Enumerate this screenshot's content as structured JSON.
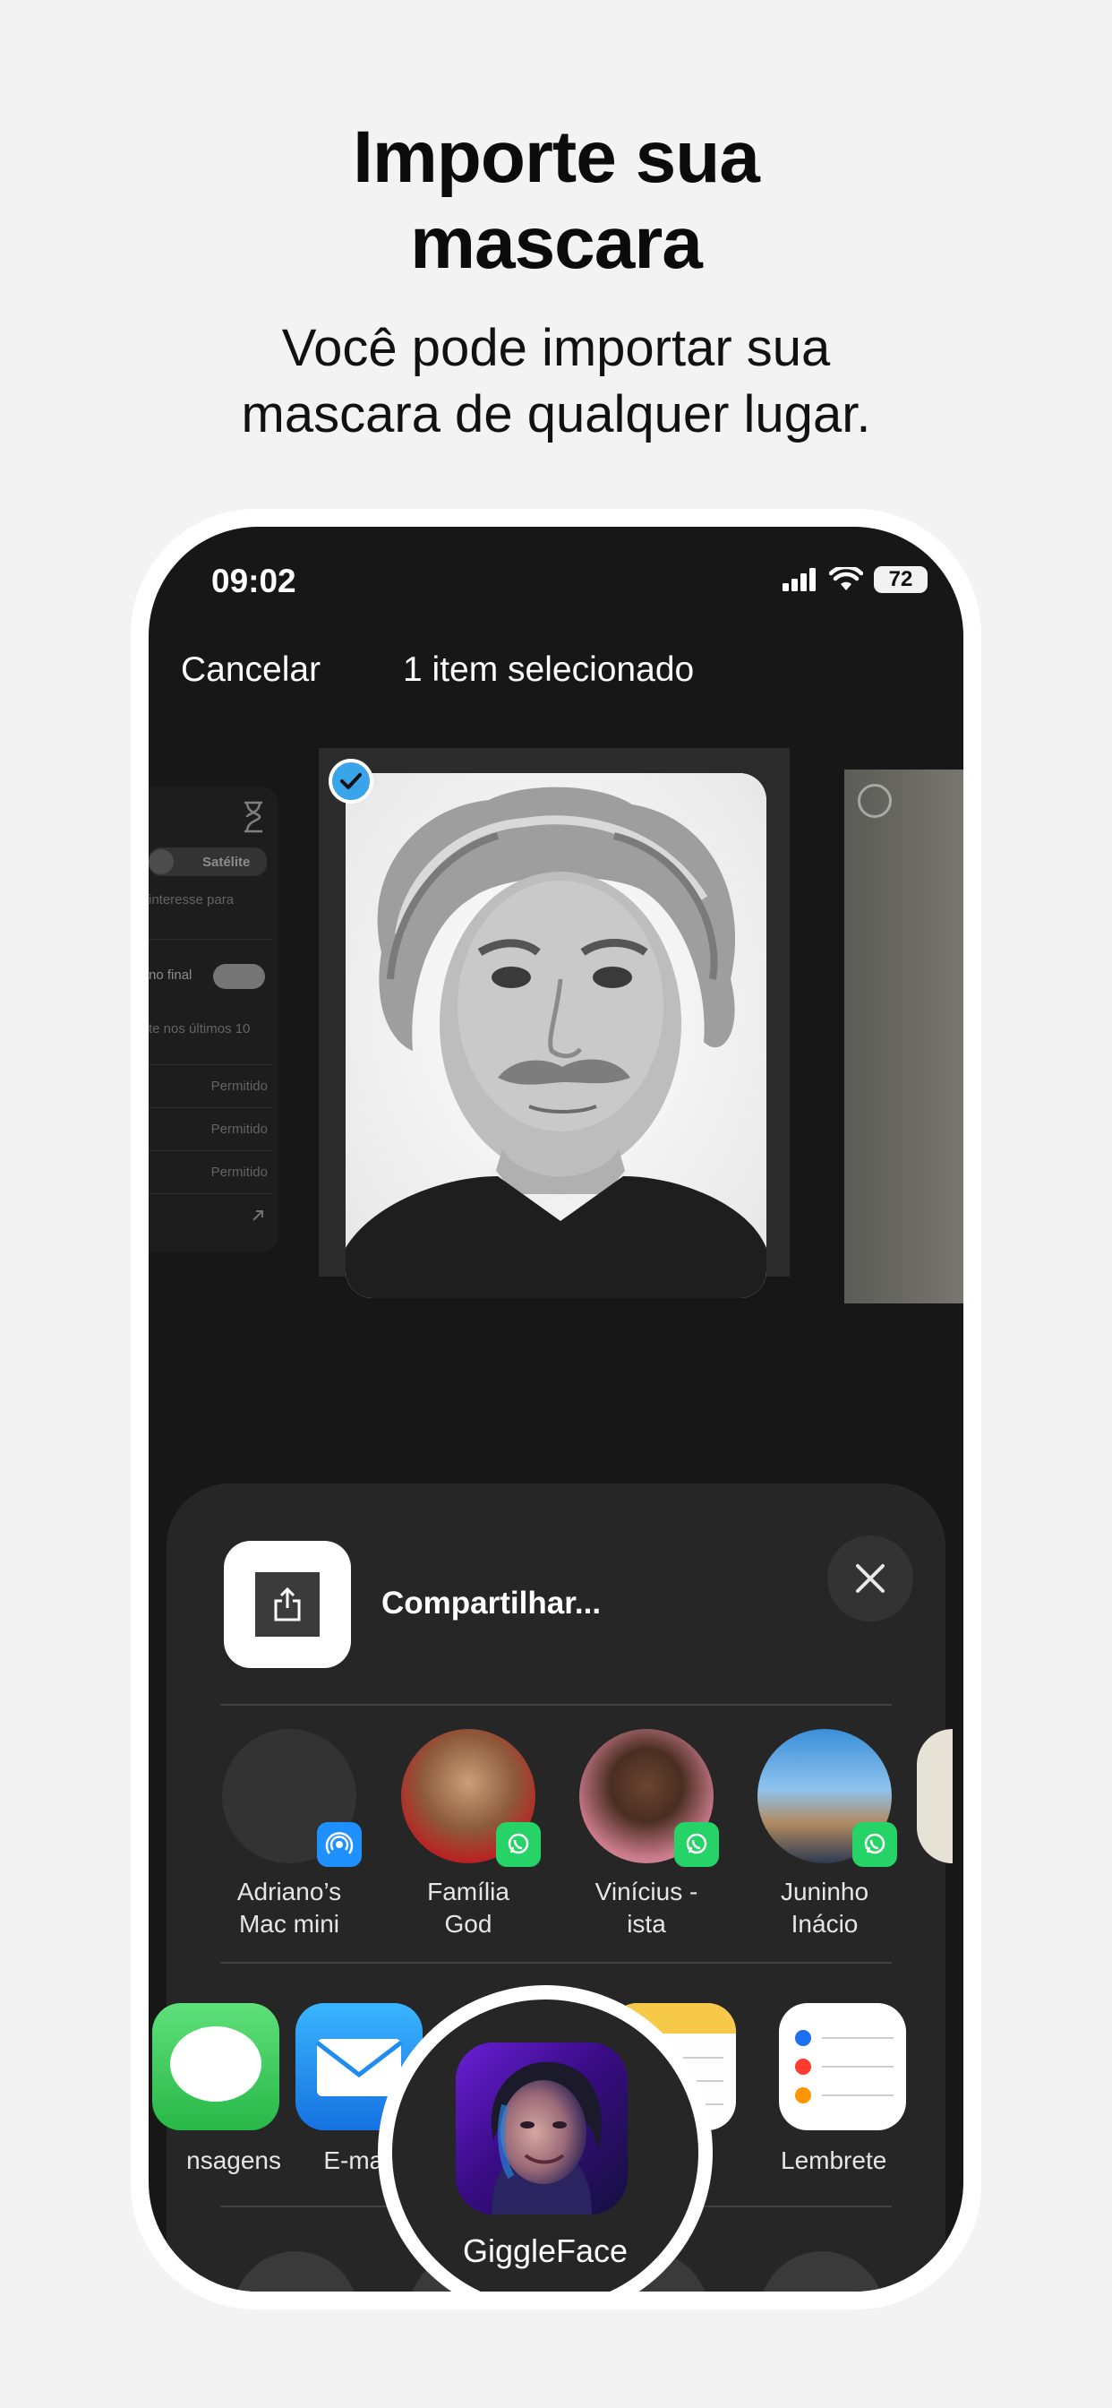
{
  "headline": {
    "title_line1": "Importe sua",
    "title_line2": "mascara",
    "subtitle_line1": "Você pode importar sua",
    "subtitle_line2": "mascara de qualquer lugar."
  },
  "status_bar": {
    "time": "09:02",
    "battery": "72"
  },
  "nav": {
    "cancel": "Cancelar",
    "title": "1 item selecionado"
  },
  "background_panel": {
    "pill_label": "Satélite",
    "text1": "interesse para",
    "toggle_label": "no final",
    "text2": "te nos últimos 10",
    "rows": [
      "Permitido",
      "Permitido",
      "Permitido"
    ]
  },
  "share_sheet": {
    "title": "Compartilhar...",
    "contacts": [
      {
        "line1": "Adriano’s",
        "line2": "Mac mini",
        "badge": "airdrop-icon"
      },
      {
        "line1": "Família",
        "line2": "God",
        "badge": "whatsapp-icon"
      },
      {
        "line1": "Vinícius -",
        "line2": "ista",
        "badge": "whatsapp-icon"
      },
      {
        "line1": "Juninho",
        "line2": "Inácio",
        "badge": "whatsapp-icon"
      }
    ],
    "apps": [
      {
        "label": "nsagens",
        "icon": "messages-icon"
      },
      {
        "label": "E-mail",
        "icon": "mail-icon"
      },
      {
        "label": "Notas",
        "icon": "notes-icon"
      },
      {
        "label": "Lembrete",
        "icon": "reminders-icon"
      }
    ],
    "highlight_app": {
      "label": "GiggleFace",
      "icon": "giggleface-icon"
    }
  },
  "colors": {
    "accent_blue": "#3aa4ea",
    "whatsapp_green": "#25d366",
    "messages_green": "#34c759",
    "mail_blue": "#1f8cf0",
    "notes_yellow": "#f7c948"
  }
}
